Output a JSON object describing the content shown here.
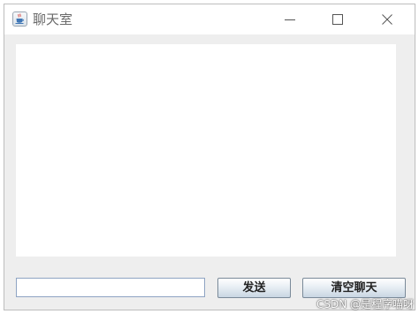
{
  "window": {
    "title": "聊天室",
    "app_icon": "java-cup-icon",
    "controls": {
      "minimize_icon": "minimize-icon",
      "maximize_icon": "maximize-icon",
      "close_icon": "close-icon"
    }
  },
  "chat": {
    "messages_text": ""
  },
  "composer": {
    "input_value": "",
    "send_label": "发送",
    "clear_label": "清空聊天"
  },
  "watermark": {
    "text": "CSDN @是程序喵呀"
  },
  "colors": {
    "window_background": "#eeeeee",
    "titlebar_background": "#ffffff",
    "title_text": "#6a6a6a",
    "button_border": "#7a8a99",
    "input_border": "#8fa4c3"
  }
}
